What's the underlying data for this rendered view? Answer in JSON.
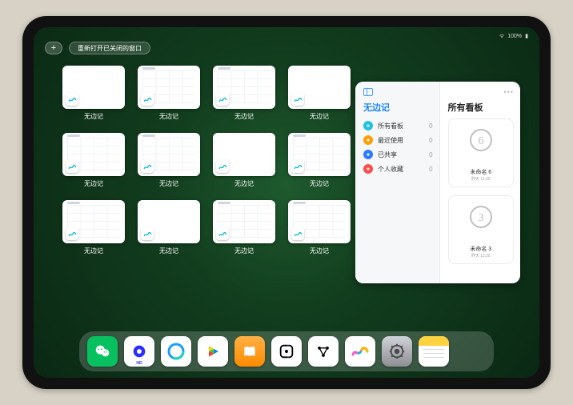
{
  "status": {
    "battery": "100%"
  },
  "topbar": {
    "plus_label": "+",
    "reopen_label": "重新打开已关闭的窗口"
  },
  "app_window_label": "无边记",
  "window_variants": [
    "blank",
    "table",
    "table",
    "blank",
    "table",
    "table",
    "blank",
    "table",
    "table",
    "blank",
    "table",
    "table"
  ],
  "sidepanel": {
    "left_title": "无边记",
    "right_title": "所有看板",
    "items": [
      {
        "label": "所有看板",
        "count": "0",
        "color": "#21c2e6"
      },
      {
        "label": "最近使用",
        "count": "0",
        "color": "#ff9f0a"
      },
      {
        "label": "已共享",
        "count": "0",
        "color": "#2e7bff"
      },
      {
        "label": "个人收藏",
        "count": "0",
        "color": "#ff4d4d"
      }
    ],
    "boards": [
      {
        "title": "未命名 6",
        "date": "昨天 11:20",
        "digit": "6"
      },
      {
        "title": "未命名 3",
        "date": "昨天 11:20",
        "digit": "3"
      }
    ]
  },
  "dock": {
    "wechat": "#07c160",
    "quark": "#2b2cff",
    "browser": "#1a9cff",
    "play": "#ffffff",
    "books": "#ff9500",
    "dice": "#ffffff",
    "graph": "#ffffff",
    "freeform": "#ffffff",
    "settings": "#8e8e93",
    "notes": "#ffffff"
  }
}
